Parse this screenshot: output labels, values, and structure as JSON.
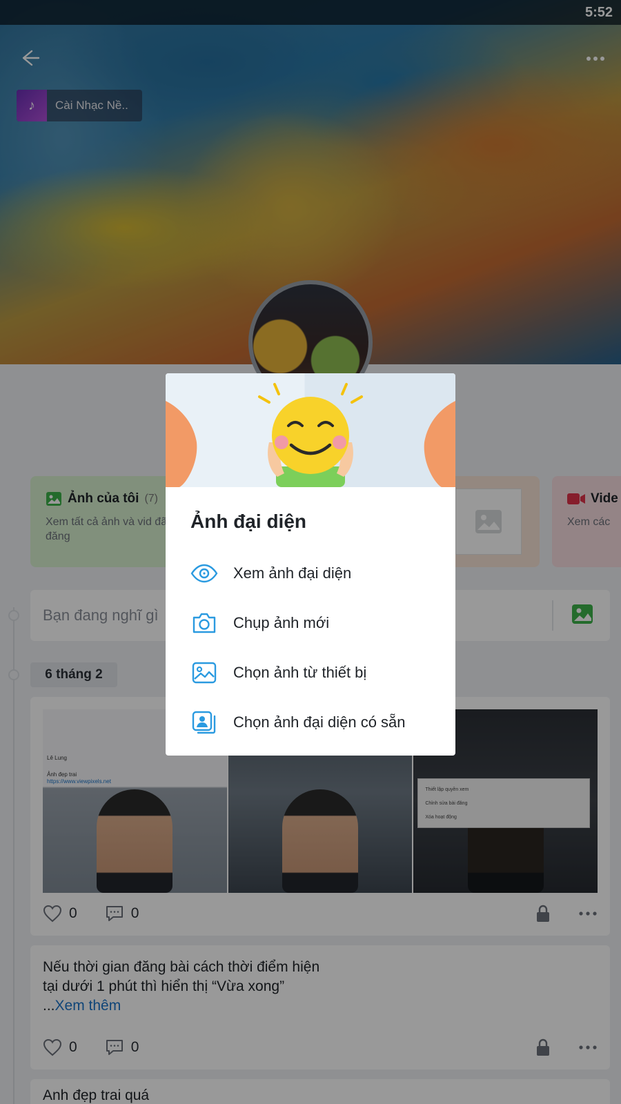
{
  "status_bar": {
    "time": "5:52"
  },
  "cover": {
    "music_chip_label": "Cài Nhạc Nề.."
  },
  "albums": {
    "photos": {
      "title": "Ảnh của tôi",
      "count": "(7)",
      "subtitle": "Xem tất cả ảnh và vid đã đăng"
    },
    "videos": {
      "title": "Vide",
      "subtitle": "Xem các"
    }
  },
  "composer": {
    "placeholder": "Bạn đang nghĩ gì"
  },
  "timeline": {
    "date_label": "6 tháng 2"
  },
  "posts": [
    {
      "photo_texts": {
        "name": "Lê Lung",
        "caption": "Ảnh đẹp trai",
        "link": "https://www.viewpixels.net",
        "menu_items": [
          "Thiết lập quyền xem",
          "Chỉnh sửa bài đăng",
          "Xóa hoạt động"
        ]
      },
      "likes": "0",
      "comments": "0"
    },
    {
      "text": "Nếu thời gian đăng bài cách thời điểm hiện tại dưới 1 phút thì hiển thị “Vừa xong”",
      "ellipsis": "...",
      "see_more": "Xem thêm",
      "likes": "0",
      "comments": "0"
    },
    {
      "text": "Anh đẹp trai quá"
    }
  ],
  "dialog": {
    "title": "Ảnh đại diện",
    "items": [
      {
        "label": "Xem ảnh đại diện",
        "icon": "eye-icon"
      },
      {
        "label": "Chụp ảnh mới",
        "icon": "camera-icon"
      },
      {
        "label": "Chọn ảnh từ thiết bị",
        "icon": "image-icon"
      },
      {
        "label": "Chọn ảnh đại diện có sẵn",
        "icon": "avatar-gallery-icon"
      }
    ]
  },
  "colors": {
    "accent": "#2a9ae0",
    "green": "#3db24a",
    "red": "#e0324a",
    "link": "#1a73c8"
  }
}
